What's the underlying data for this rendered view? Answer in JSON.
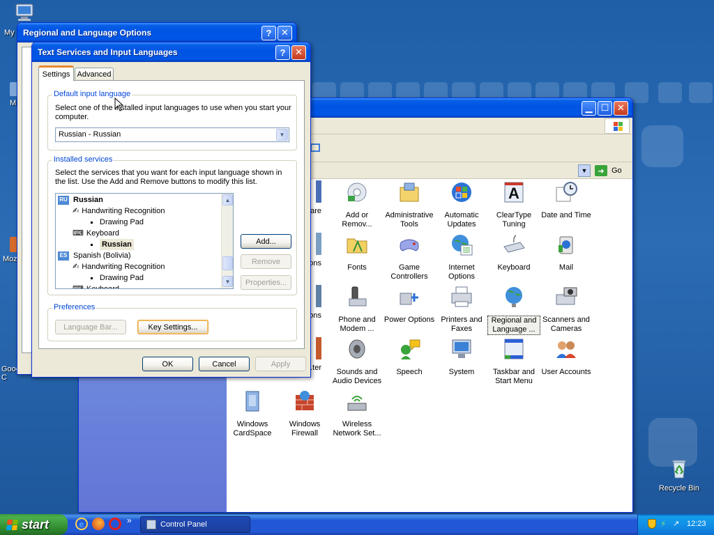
{
  "desktop": {
    "icons": [
      {
        "label": "My"
      },
      {
        "label": "M"
      },
      {
        "label": "Moz"
      },
      {
        "label": "Google C"
      }
    ],
    "recycle_bin": {
      "label": "Recycle Bin"
    }
  },
  "regional_window": {
    "title": "Regional and Language Options",
    "help": "?",
    "close": "✕"
  },
  "control_panel": {
    "go_label": "Go",
    "items": [
      {
        "label": "...ware"
      },
      {
        "label": "Add or Remov..."
      },
      {
        "label": "Administrative Tools"
      },
      {
        "label": "Automatic Updates"
      },
      {
        "label": "ClearType Tuning"
      },
      {
        "label": "Date and Time"
      },
      {
        "label": "...tions"
      },
      {
        "label": "Fonts"
      },
      {
        "label": "Game Controllers"
      },
      {
        "label": "Internet Options"
      },
      {
        "label": "Keyboard"
      },
      {
        "label": "Mail"
      },
      {
        "label": "...rk ...ions"
      },
      {
        "label": "Phone and Modem ..."
      },
      {
        "label": "Power Options"
      },
      {
        "label": "Printers and Faxes"
      },
      {
        "label": "Regional and Language ..."
      },
      {
        "label": "Scanners and Cameras"
      },
      {
        "label": "...cy ...ter"
      },
      {
        "label": "Sounds and Audio Devices"
      },
      {
        "label": "Speech"
      },
      {
        "label": "System"
      },
      {
        "label": "Taskbar and Start Menu"
      },
      {
        "label": "User Accounts"
      },
      {
        "label": "Windows CardSpace"
      },
      {
        "label": "Windows Firewall"
      },
      {
        "label": "Wireless Network Set..."
      }
    ]
  },
  "text_services": {
    "title": "Text Services and Input Languages",
    "help": "?",
    "close": "✕",
    "tabs": [
      {
        "label": "Settings"
      },
      {
        "label": "Advanced"
      }
    ],
    "default_group": {
      "legend": "Default input language",
      "description": "Select one of the installed input languages to use when you start your computer.",
      "selected": "Russian - Russian"
    },
    "services_group": {
      "legend": "Installed services",
      "description": "Select the services that you want for each input language shown in the list. Use the Add and Remove buttons to modify this list.",
      "tree": [
        {
          "text": "RU",
          "label": "Russian"
        },
        {
          "label": "Handwriting Recognition"
        },
        {
          "label": "Drawing Pad"
        },
        {
          "label": "Keyboard"
        },
        {
          "label": "Russian"
        },
        {
          "text": "ES",
          "label": "Spanish (Bolivia)"
        },
        {
          "label": "Handwriting Recognition"
        },
        {
          "label": "Drawing Pad"
        },
        {
          "label": "Keyboard"
        }
      ],
      "add": "Add...",
      "remove": "Remove",
      "properties": "Properties..."
    },
    "preferences_group": {
      "legend": "Preferences",
      "language_bar": "Language Bar...",
      "key_settings": "Key Settings..."
    },
    "ok": "OK",
    "cancel": "Cancel",
    "apply": "Apply"
  },
  "taskbar": {
    "start": "start",
    "task": "Control Panel",
    "clock": "12:23",
    "chevron": "»"
  }
}
